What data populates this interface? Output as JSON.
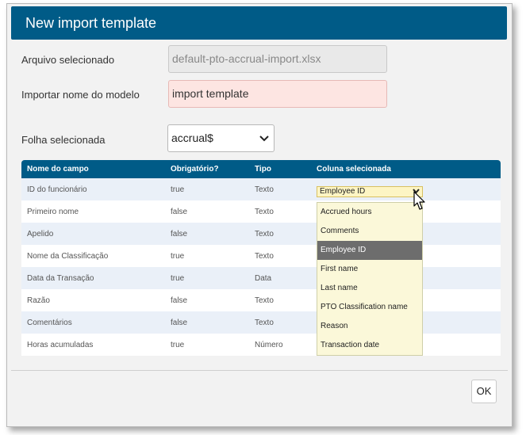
{
  "dialog": {
    "title": "New import template",
    "ok_label": "OK"
  },
  "form": {
    "file_label": "Arquivo selecionado",
    "file_value": "default-pto-accrual-import.xlsx",
    "template_name_label": "Importar nome do modelo",
    "template_name_value": "import template",
    "sheet_label": "Folha selecionada",
    "sheet_value": "accrual$"
  },
  "table": {
    "headers": [
      "Nome do campo",
      "Obrigatório?",
      "Tipo",
      "Coluna selecionada"
    ],
    "rows": [
      {
        "field": "ID do funcionário",
        "required": "true",
        "type": "Texto"
      },
      {
        "field": "Primeiro nome",
        "required": "false",
        "type": "Texto"
      },
      {
        "field": "Apelido",
        "required": "false",
        "type": "Texto"
      },
      {
        "field": "Nome da Classificação",
        "required": "true",
        "type": "Texto"
      },
      {
        "field": "Data da Transação",
        "required": "true",
        "type": "Data"
      },
      {
        "field": "Razão",
        "required": "false",
        "type": "Texto"
      },
      {
        "field": "Comentários",
        "required": "false",
        "type": "Texto"
      },
      {
        "field": "Horas acumuladas",
        "required": "true",
        "type": "Número"
      }
    ]
  },
  "column_select": {
    "value": "Employee ID",
    "options": [
      "Accrued hours",
      "Comments",
      "Employee ID",
      "First name",
      "Last name",
      "PTO Classification name",
      "Reason",
      "Transaction date"
    ],
    "selected_index": 2
  },
  "colors": {
    "header_blue": "#005b87",
    "required_field_bg": "#fde5e2",
    "dropdown_bg": "#fbf8d9",
    "selected_option_bg": "#6d6d6d"
  }
}
